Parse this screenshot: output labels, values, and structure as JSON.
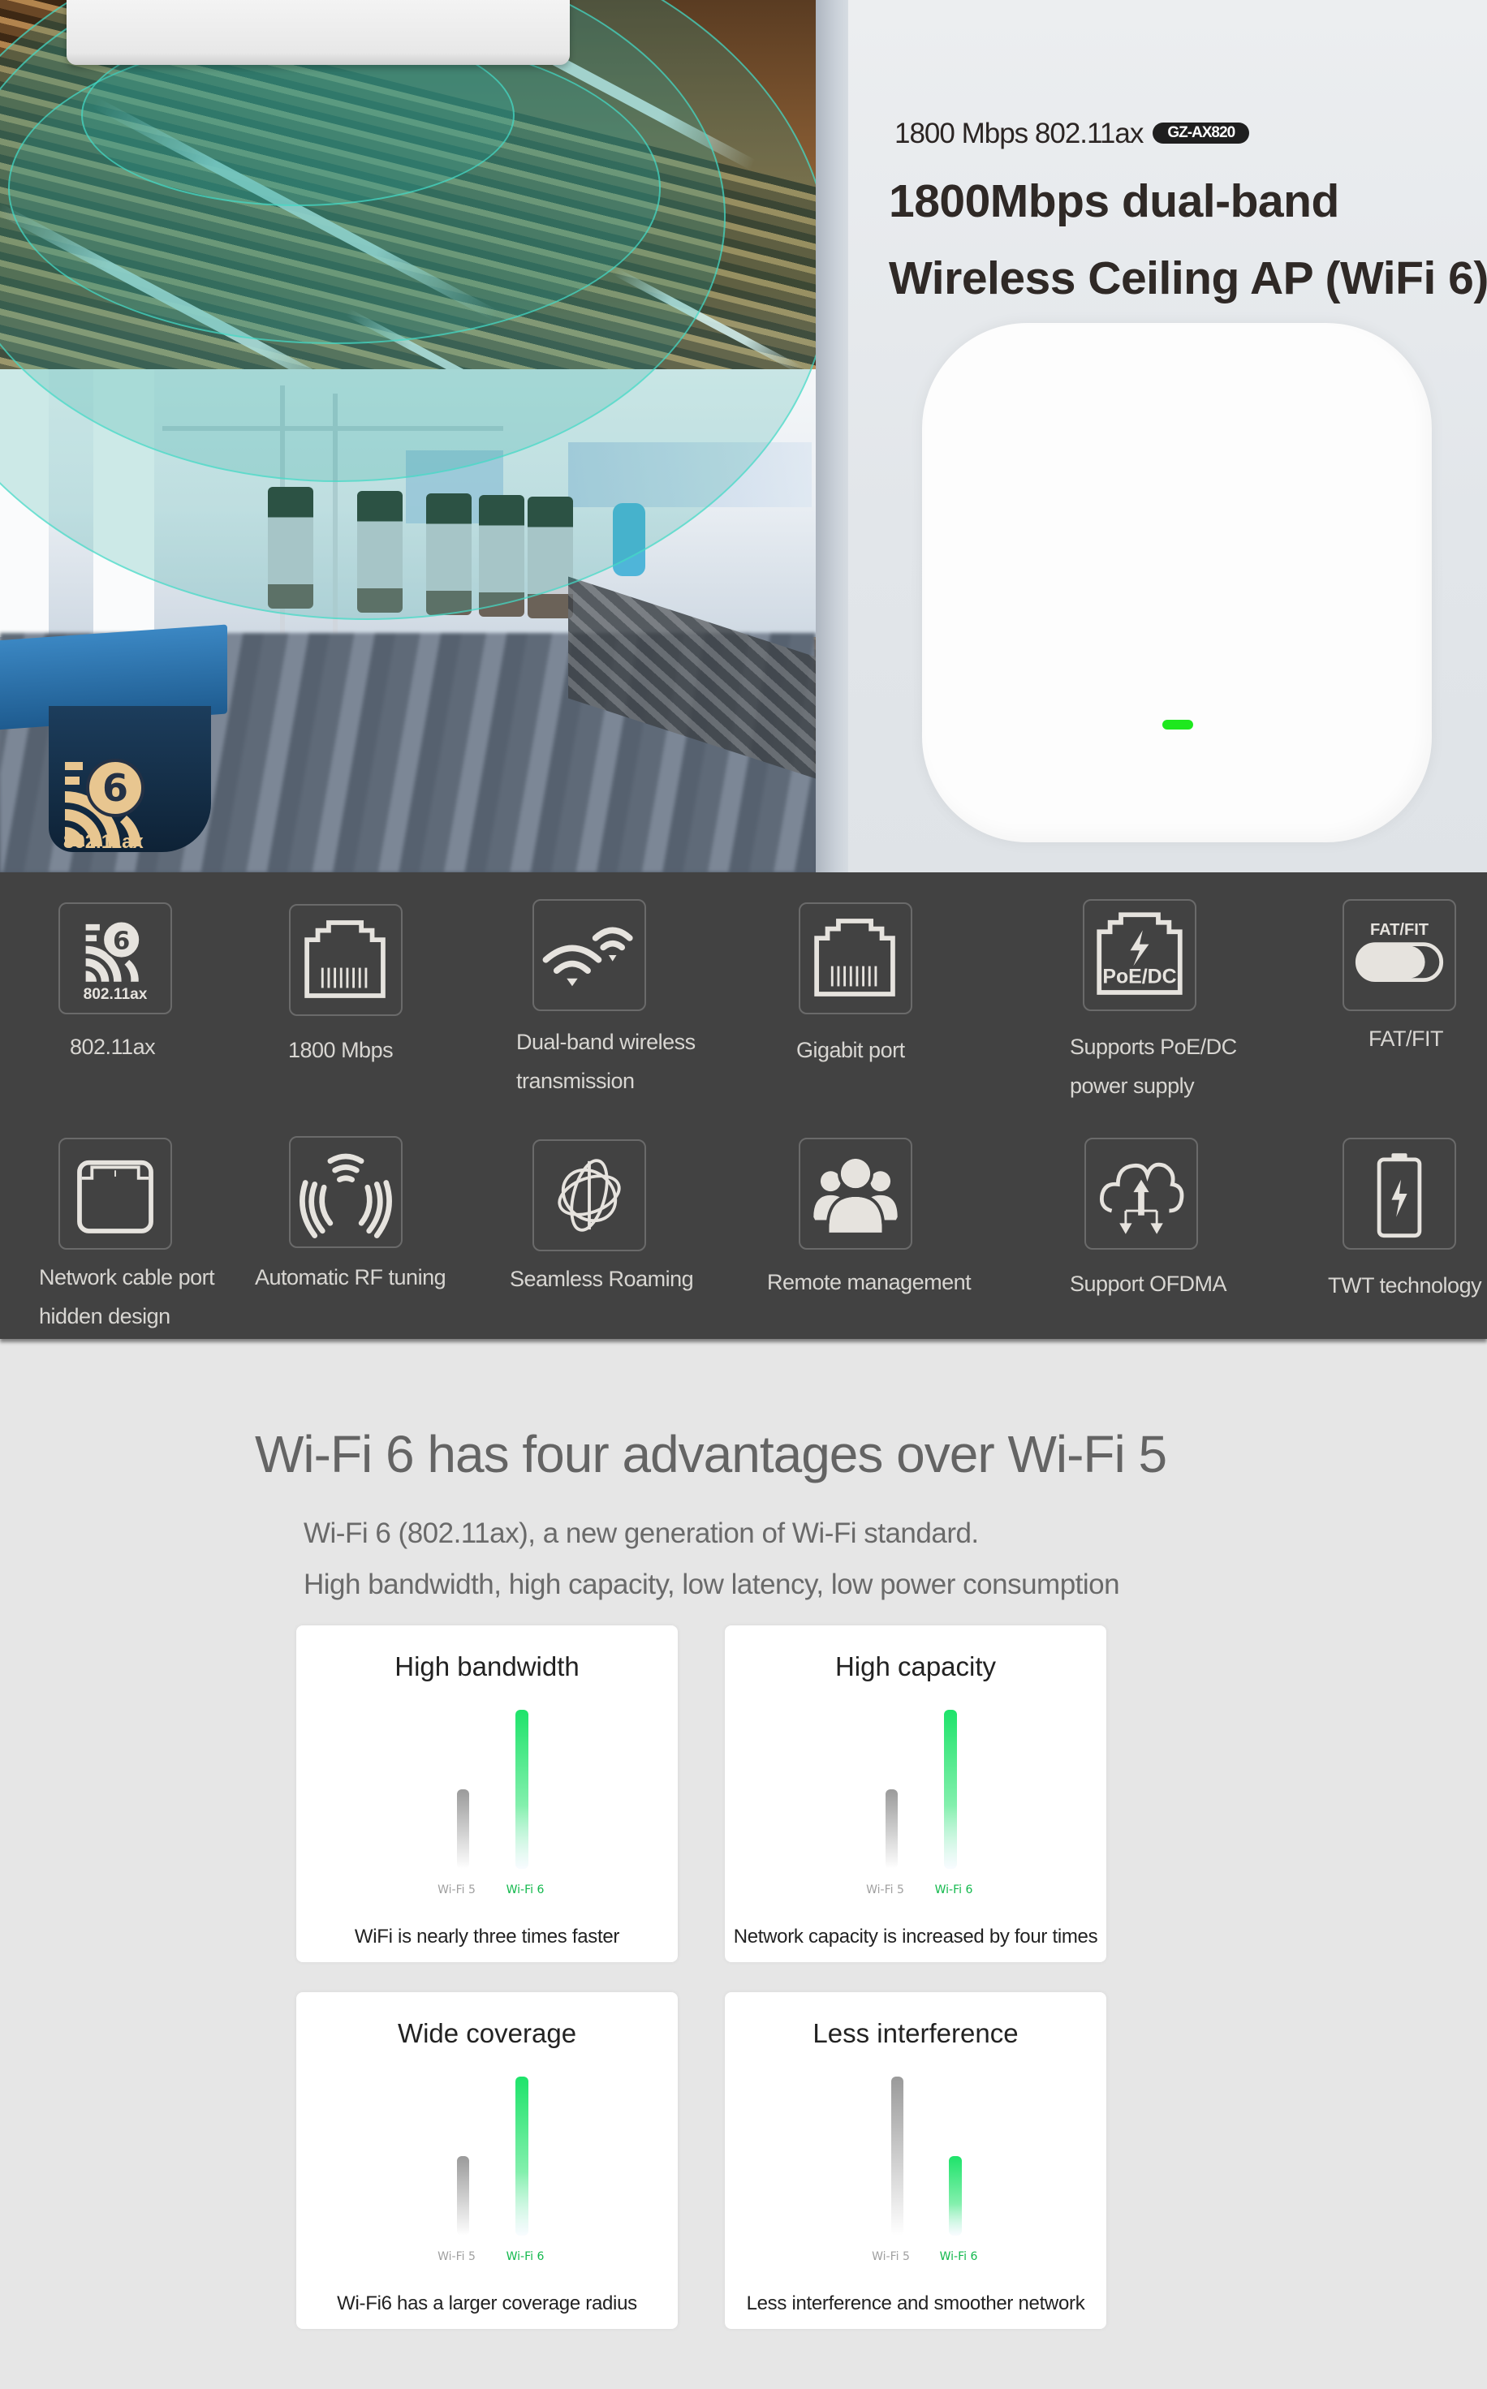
{
  "hero": {
    "spec_line": "1800 Mbps 802.11ax",
    "model_badge": "GZ-AX820",
    "title_line1": "1800Mbps dual-band",
    "title_line2": "Wireless Ceiling AP (WiFi 6)",
    "logo": {
      "icon": "wifi6-icon",
      "text": "802.11ax"
    },
    "led_color": "#1ee81e"
  },
  "features": [
    {
      "icon": "wifi6-icon",
      "label_lines": [
        "802.11ax"
      ]
    },
    {
      "icon": "ethernet-port-icon",
      "label_lines": [
        "1800 Mbps"
      ]
    },
    {
      "icon": "dual-wifi-icon",
      "label_lines": [
        "Dual-band wireless",
        "transmission"
      ]
    },
    {
      "icon": "ethernet-port-icon",
      "label_lines": [
        "Gigabit port"
      ]
    },
    {
      "icon": "poe-dc-icon",
      "icon_text": "PoE/DC",
      "label_lines": [
        "Supports PoE/DC",
        "power supply"
      ]
    },
    {
      "icon": "toggle-switch-icon",
      "icon_text": "FAT/FIT",
      "label_lines": [
        "FAT/FIT"
      ]
    },
    {
      "icon": "hidden-port-icon",
      "label_lines": [
        "Network cable port",
        "hidden design"
      ]
    },
    {
      "icon": "rf-signal-icon",
      "label_lines": [
        "Automatic RF tuning"
      ]
    },
    {
      "icon": "roaming-globe-icon",
      "label_lines": [
        "Seamless Roaming"
      ]
    },
    {
      "icon": "users-group-icon",
      "label_lines": [
        "Remote management"
      ]
    },
    {
      "icon": "cloud-updown-icon",
      "label_lines": [
        "Support OFDMA"
      ]
    },
    {
      "icon": "battery-bolt-icon",
      "label_lines": [
        "TWT technology"
      ]
    }
  ],
  "advantages": {
    "title": "Wi-Fi 6 has four advantages over Wi-Fi 5",
    "subtitle1": "Wi-Fi 6 (802.11ax), a new generation of Wi-Fi standard.",
    "subtitle2": "High bandwidth, high capacity, low latency, low power consumption",
    "colors": {
      "wifi5": "#9a9a9a",
      "wifi6": "#1ee36a"
    }
  },
  "chart_data": [
    {
      "type": "bar",
      "title": "High bandwidth",
      "categories": [
        "Wi-Fi 5",
        "Wi-Fi 6"
      ],
      "values": [
        0.5,
        1.0
      ],
      "caption": "WiFi is nearly three times faster",
      "xlabel": "",
      "ylabel": "",
      "ylim": [
        0,
        1
      ]
    },
    {
      "type": "bar",
      "title": "High capacity",
      "categories": [
        "Wi-Fi 5",
        "Wi-Fi 6"
      ],
      "values": [
        0.5,
        1.0
      ],
      "caption": "Network capacity is increased by four times",
      "xlabel": "",
      "ylabel": "",
      "ylim": [
        0,
        1
      ]
    },
    {
      "type": "bar",
      "title": "Wide coverage",
      "categories": [
        "Wi-Fi 5",
        "Wi-Fi 6"
      ],
      "values": [
        0.5,
        1.0
      ],
      "caption": "Wi-Fi6 has a larger coverage radius",
      "xlabel": "",
      "ylabel": "",
      "ylim": [
        0,
        1
      ]
    },
    {
      "type": "bar",
      "title": "Less interference",
      "categories": [
        "Wi-Fi 5",
        "Wi-Fi 6"
      ],
      "values": [
        1.0,
        0.5
      ],
      "caption": "Less interference and smoother network",
      "xlabel": "",
      "ylabel": "",
      "ylim": [
        0,
        1
      ]
    }
  ]
}
